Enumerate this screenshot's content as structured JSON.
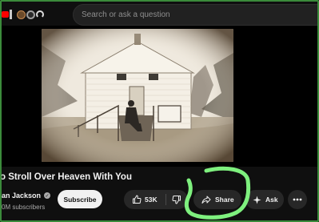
{
  "topbar": {
    "search_placeholder": "Search or ask a question",
    "tab_icons": [
      "youtube-logo-icon",
      "tab-icon",
      "tab-icon",
      "tab-icon",
      "headphones-icon"
    ]
  },
  "video": {
    "title": "o Stroll Over Heaven With You",
    "thumbnail": "sepia-photo-white-chapel"
  },
  "channel": {
    "name": "an Jackson",
    "subscribers": "0M subscribers",
    "verified": true
  },
  "actions": {
    "subscribe_label": "Subscribe",
    "like_count": "53K",
    "share_label": "Share",
    "ask_label": "Ask",
    "more_icon": "ellipsis-icon"
  },
  "colors": {
    "background": "#0f0f0f",
    "pill": "#272727",
    "subscribe_bg": "#f1f1f1",
    "highlight_marker": "#7ef07e",
    "window_border": "#3b8b3b"
  }
}
